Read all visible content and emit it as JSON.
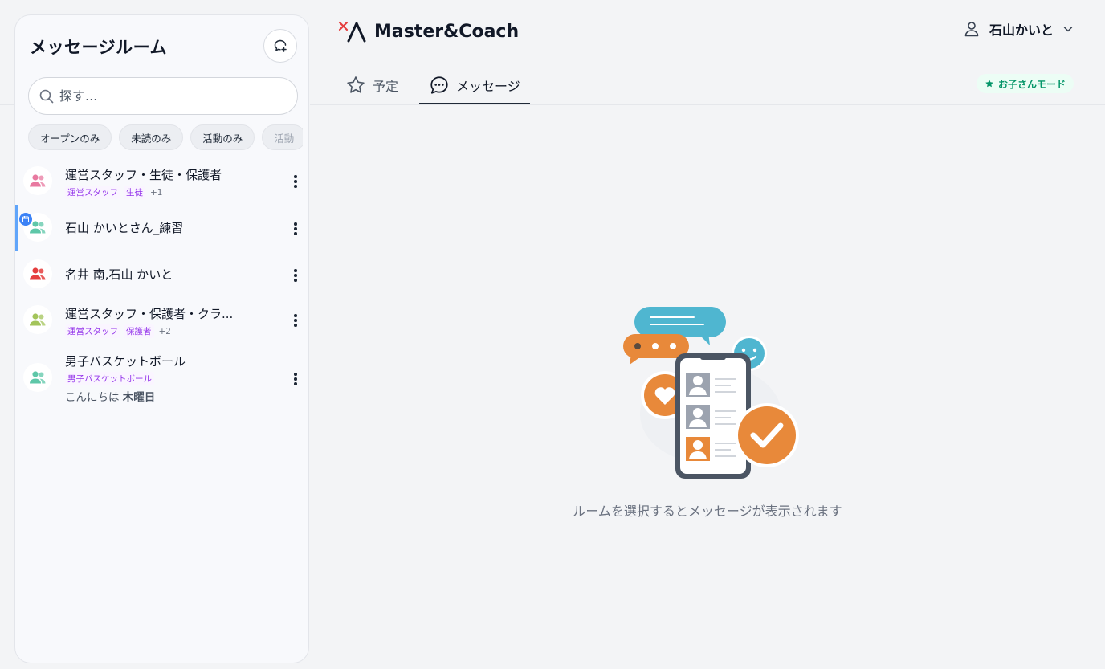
{
  "app": {
    "name": "Master&Coach"
  },
  "sidebar": {
    "title": "メッセージルーム",
    "search_placeholder": "探す...",
    "filters": [
      "オープンのみ",
      "未読のみ",
      "活動のみ",
      "活動"
    ],
    "rooms": [
      {
        "name": "運営スタッフ・生徒・保護者",
        "tags": [
          "運営スタッフ",
          "生徒"
        ],
        "more": "+1",
        "avatar_color": "#e879a0"
      },
      {
        "name": "石山 かいとさん_練習",
        "avatar_color": "#5ec7a8",
        "active": true
      },
      {
        "name": "名井 南,石山 かいと",
        "avatar_color": "#e53e3e"
      },
      {
        "name": "運営スタッフ・保護者・クラ...",
        "tags": [
          "運営スタッフ",
          "保護者"
        ],
        "more": "+2",
        "avatar_color": "#a3c45a"
      },
      {
        "name": "男子バスケットボール",
        "tags": [
          "男子バスケットボール"
        ],
        "preview_text": "こんにちは",
        "preview_time": "木曜日",
        "avatar_color": "#5ec7a8"
      }
    ]
  },
  "header": {
    "user_name": "石山かいと",
    "tabs": [
      {
        "label": "予定"
      },
      {
        "label": "メッセージ",
        "active": true
      }
    ],
    "kids_mode_label": "お子さんモード"
  },
  "main": {
    "empty_message": "ルームを選択するとメッセージが表示されます"
  },
  "colors": {
    "accent_active": "#60a5fa",
    "tag": "#9333ea",
    "kids_mode": "#059669",
    "illustration_orange": "#e8893a",
    "illustration_teal": "#4fb6d0"
  }
}
